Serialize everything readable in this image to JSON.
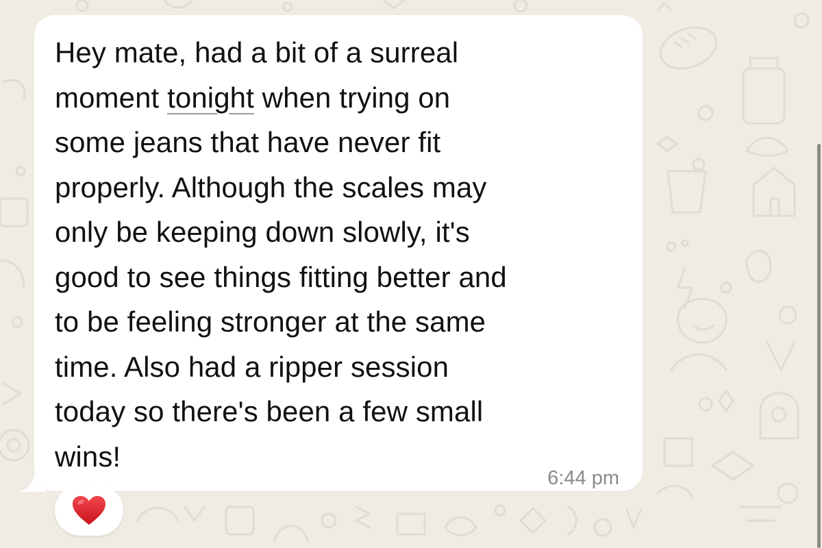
{
  "message": {
    "lines": [
      [
        "Hey mate, had a bit of a surreal"
      ],
      [
        "moment ",
        "tonight",
        " when trying on"
      ],
      [
        "some jeans that have never fit"
      ],
      [
        "properly. Although the scales may"
      ],
      [
        "only be keeping down slowly, it's"
      ],
      [
        "good to see things fitting better and"
      ],
      [
        "to be feeling stronger at the same"
      ],
      [
        "time. Also had a ripper session"
      ],
      [
        "today so there's been a few small"
      ],
      [
        "wins!"
      ]
    ],
    "timestamp": "6:44 pm"
  },
  "reaction": {
    "icon": "red-heart-icon",
    "color": "#e0222a"
  },
  "theme": {
    "chat_background": "#f0ebe3",
    "doodle_color": "#e2dbcf",
    "bubble_color": "#ffffff",
    "text_color": "#111111",
    "timestamp_color": "#8a8a8a"
  }
}
